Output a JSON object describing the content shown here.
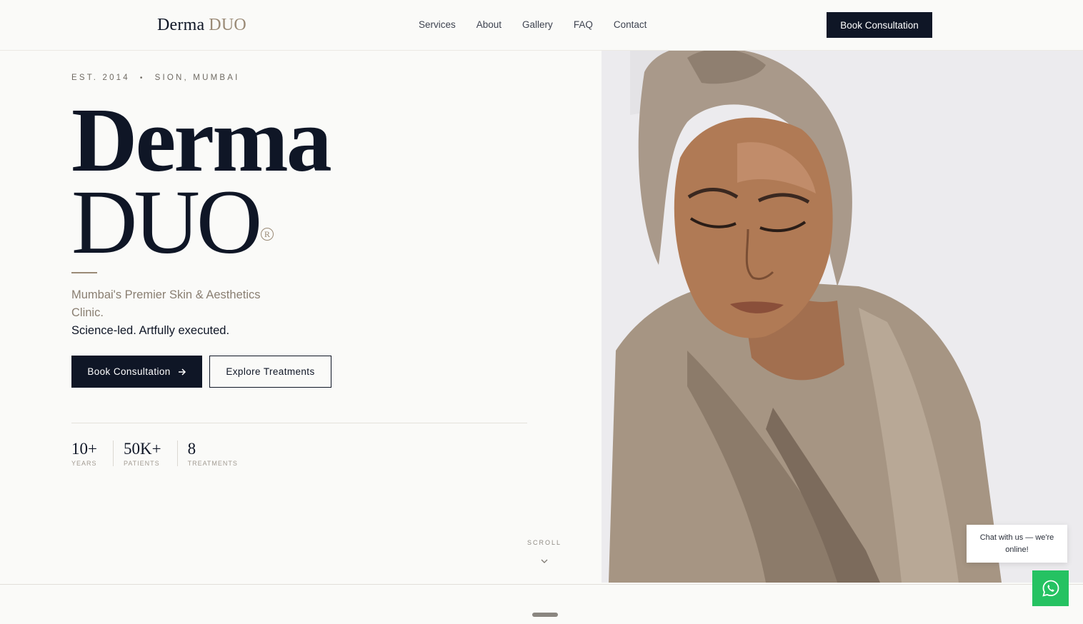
{
  "header": {
    "logo_primary": "Derma",
    "logo_secondary": "DUO",
    "nav": [
      {
        "label": "Services"
      },
      {
        "label": "About"
      },
      {
        "label": "Gallery"
      },
      {
        "label": "FAQ"
      },
      {
        "label": "Contact"
      }
    ],
    "cta_label": "Book Consultation"
  },
  "hero": {
    "eyebrow_left": "EST. 2014",
    "eyebrow_sep": "•",
    "eyebrow_right": "SION, MUMBAI",
    "title_line1": "Derma",
    "title_line2": "DUO",
    "registered_mark": "R",
    "subtitle": "Mumbai's Premier Skin & Aesthetics Clinic.",
    "tagline": "Science-led. Artfully executed.",
    "primary_button": "Book Consultation",
    "secondary_button": "Explore Treatments",
    "stats": [
      {
        "value": "10+",
        "label": "YEARS"
      },
      {
        "value": "50K+",
        "label": "PATIENTS"
      },
      {
        "value": "8",
        "label": "TREATMENTS"
      }
    ],
    "scroll_label": "SCROLL"
  },
  "chat": {
    "bubble_text": "Chat with us — we're online!",
    "button_icon": "whatsapp-icon"
  },
  "colors": {
    "navy": "#0f1626",
    "accent": "#9a8a76",
    "whatsapp_green": "#25c262",
    "background": "#fafaf8"
  }
}
